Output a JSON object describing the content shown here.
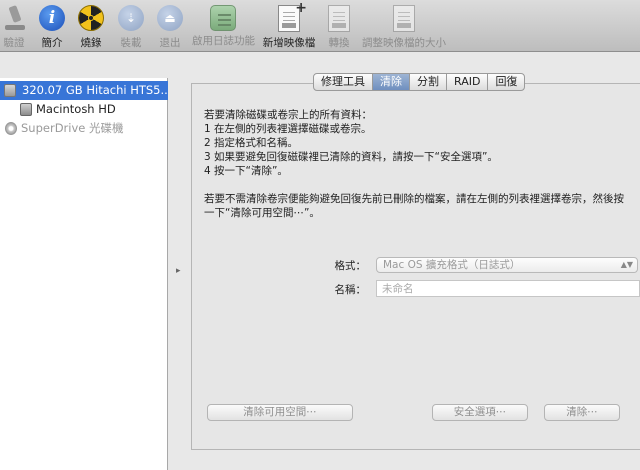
{
  "toolbar": {
    "verify": "驗證",
    "info": "簡介",
    "burn": "燒錄",
    "mount": "裝載",
    "eject": "退出",
    "enable_journaling": "啟用日誌功能",
    "new_image": "新增映像檔",
    "convert": "轉換",
    "resize_image": "調整映像檔的大小"
  },
  "sidebar": {
    "items": [
      {
        "label": "320.07 GB Hitachi HTS5..."
      },
      {
        "label": "Macintosh HD"
      },
      {
        "label": "SuperDrive 光碟機"
      }
    ]
  },
  "tabs": [
    "修理工具",
    "清除",
    "分割",
    "RAID",
    "回復"
  ],
  "instructions": {
    "line1": "若要清除磁碟或卷宗上的所有資料：",
    "line2": "1  在左側的列表裡選擇磁碟或卷宗。",
    "line3": "2  指定格式和名稱。",
    "line4": "3  如果要避免回復磁碟裡已清除的資料，請按一下“安全選項”。",
    "line5": "4  按一下“清除”。",
    "para2": "若要不需清除卷宗便能夠避免回復先前已刪除的檔案，請在左側的列表裡選擇卷宗，然後按一下“清除可用空間⋯”。"
  },
  "form": {
    "format_label": "格式：",
    "format_value": "Mac OS 擴充格式（日誌式）",
    "name_label": "名稱：",
    "name_placeholder": "未命名"
  },
  "buttons": {
    "erase_free_space": "清除可用空間⋯",
    "security_options": "安全選項⋯",
    "erase": "清除⋯"
  }
}
